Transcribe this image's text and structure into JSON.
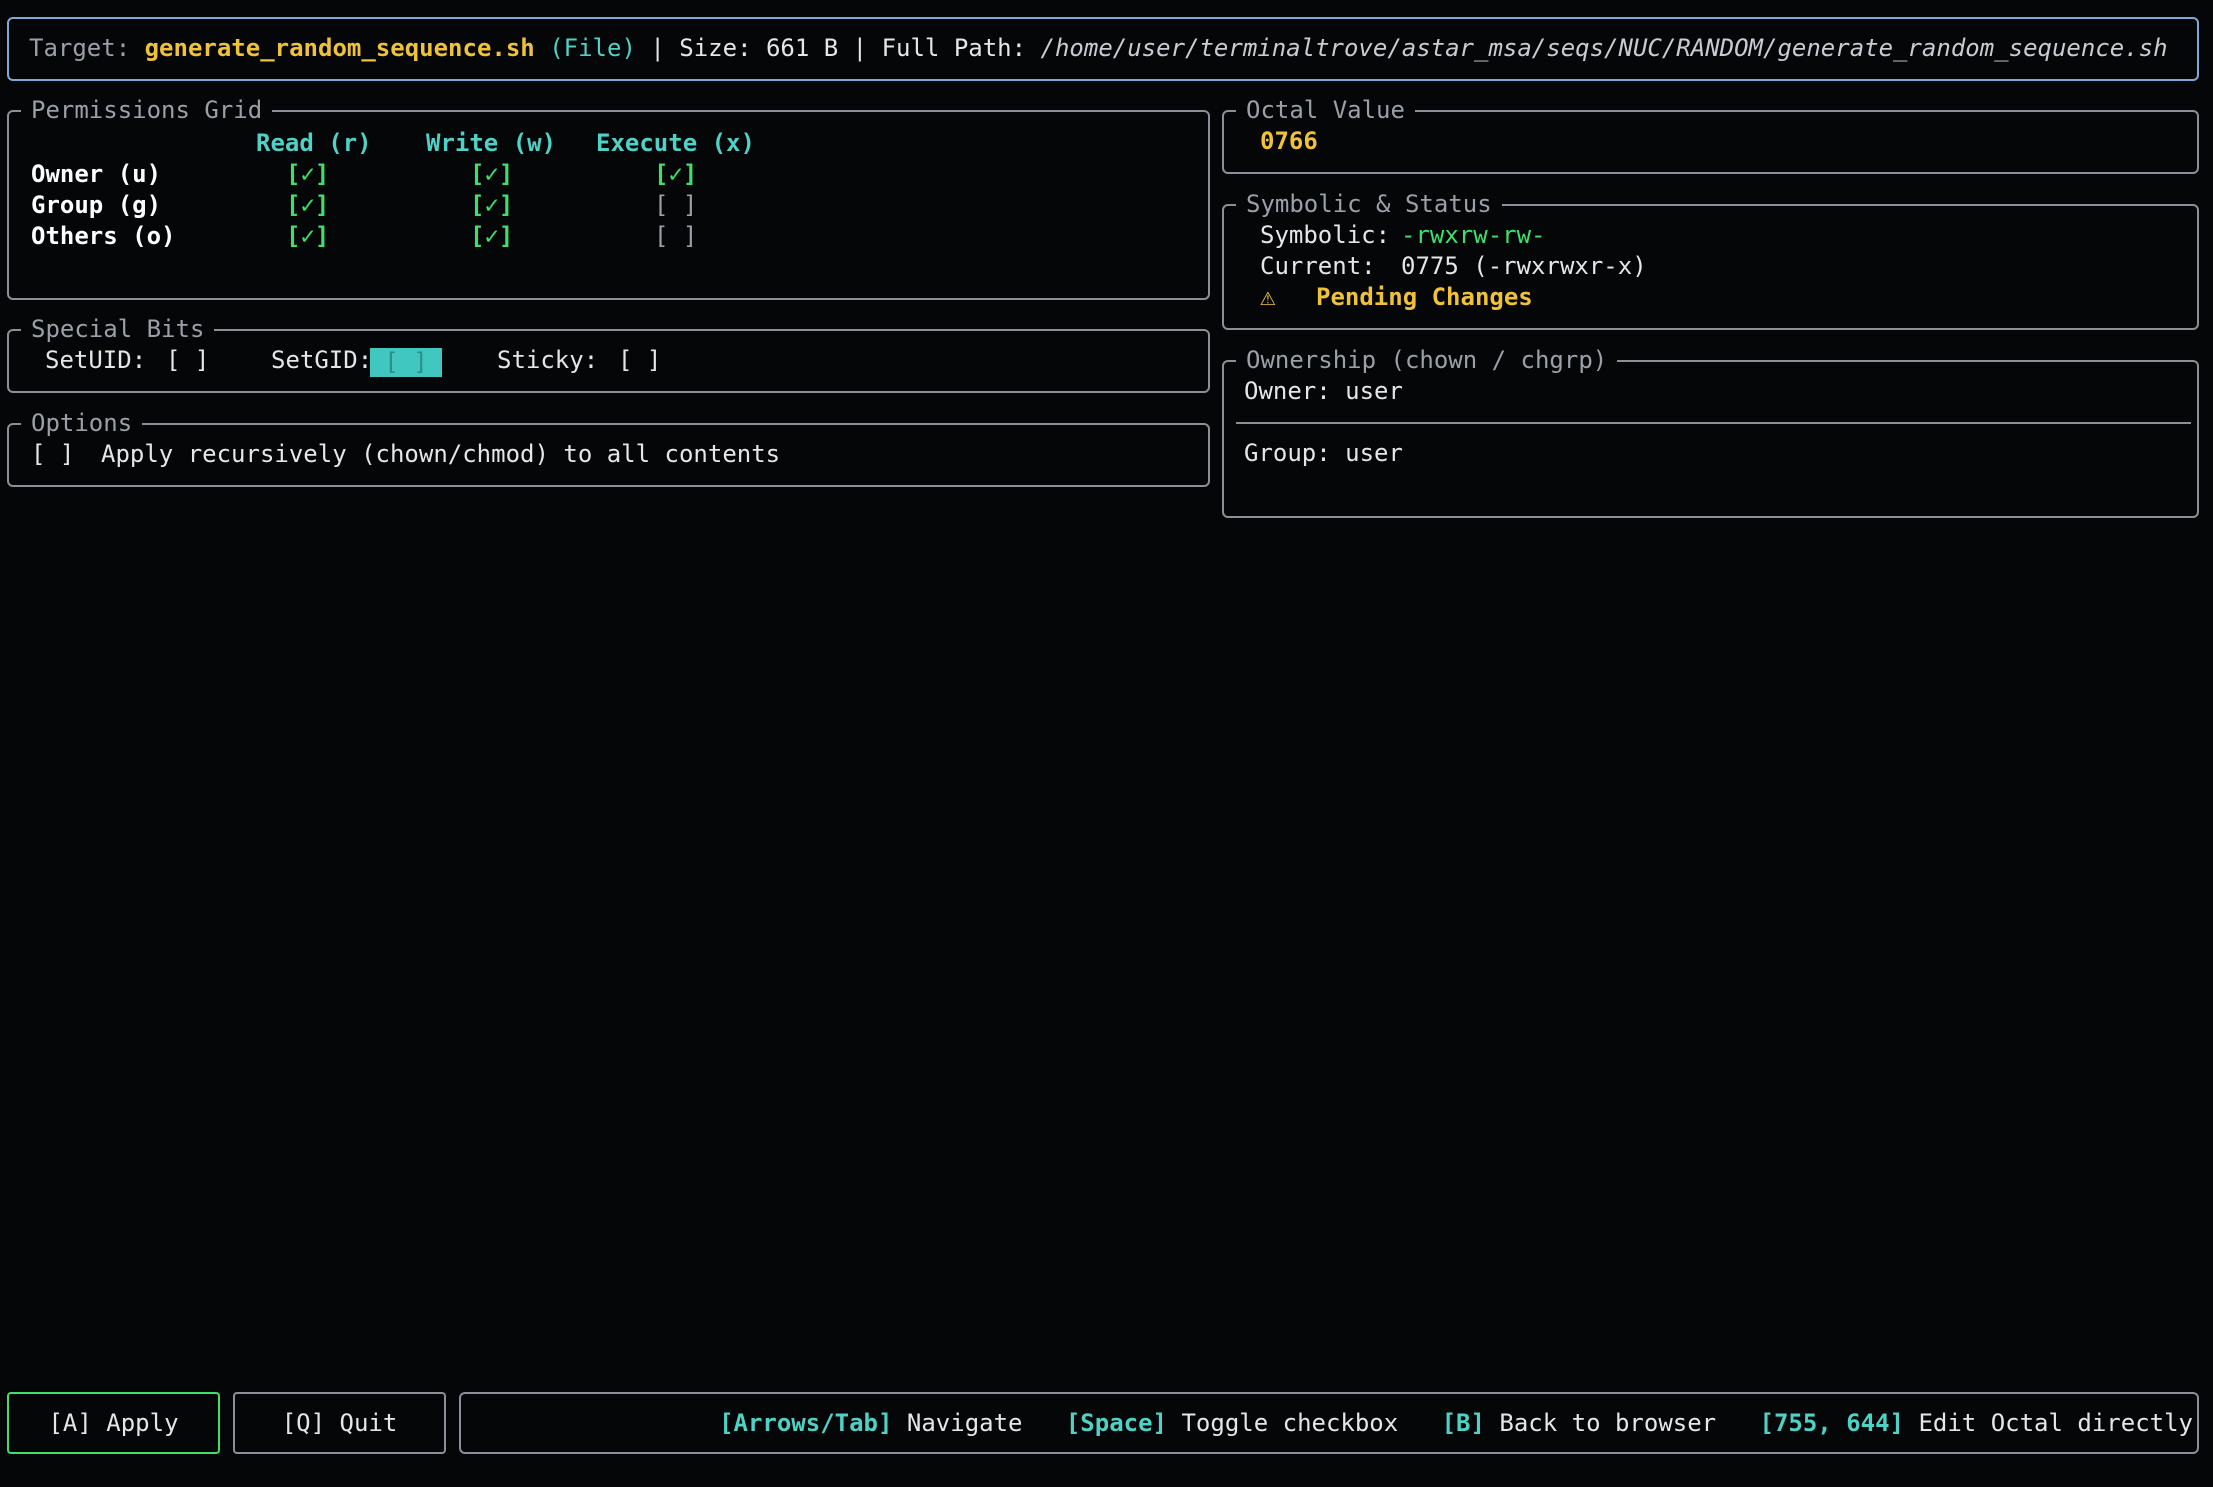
{
  "header": {
    "target_label": "Target:",
    "filename": "generate_random_sequence.sh",
    "type": "(File)",
    "sep1": "|",
    "size_label": "Size:",
    "size_value": "661 B",
    "sep2": "|",
    "path_label": "Full Path:",
    "path_value": "/home/user/terminaltrove/astar_msa/seqs/NUC/RANDOM/generate_random_sequence.sh"
  },
  "permissions": {
    "title": "Permissions Grid",
    "columns": [
      "Read (r)",
      "Write (w)",
      "Execute (x)"
    ],
    "rows": [
      {
        "label": "Owner (u)",
        "cells": [
          "[✓]",
          "[✓]",
          "[✓]"
        ]
      },
      {
        "label": "Group (g)",
        "cells": [
          "[✓]",
          "[✓]",
          "[ ]"
        ]
      },
      {
        "label": "Others (o)",
        "cells": [
          "[✓]",
          "[✓]",
          "[ ]"
        ]
      }
    ]
  },
  "special_bits": {
    "title": "Special Bits",
    "setuid_label": "SetUID:",
    "setuid_value": "[ ]",
    "setgid_label": "SetGID:",
    "setgid_value": "[ ]",
    "sticky_label": "Sticky:",
    "sticky_value": "[ ]"
  },
  "options": {
    "title": "Options",
    "recursive_checkbox": "[ ]",
    "recursive_label": "Apply recursively (chown/chmod) to all contents"
  },
  "octal": {
    "title": "Octal Value",
    "value": "0766"
  },
  "symbolic": {
    "title": "Symbolic & Status",
    "symbolic_label": "Symbolic:",
    "symbolic_value": "-rwxrw-rw-",
    "current_label": "Current:",
    "current_value": "0775 (-rwxrwxr-x)",
    "status_icon": "⚠",
    "status_text": "Pending Changes"
  },
  "ownership": {
    "title": "Ownership (chown / chgrp)",
    "owner_label": "Owner: user",
    "group_label": "Group: user"
  },
  "footer": {
    "apply_button": "[A] Apply",
    "quit_button": "[Q] Quit",
    "hints": [
      {
        "key": "[Arrows/Tab]",
        "desc": "Navigate"
      },
      {
        "key": "[Space]",
        "desc": "Toggle checkbox"
      },
      {
        "key": "[B]",
        "desc": "Back to browser"
      },
      {
        "key": "[755, 644]",
        "desc": "Edit Octal directly"
      }
    ]
  },
  "colors": {
    "background": "#050608",
    "border": "#8a8f98",
    "accent_yellow": "#f0c23a",
    "accent_cyan": "#4fd1c5",
    "accent_green": "#3ee06b",
    "header_border": "#7fa8d8"
  }
}
